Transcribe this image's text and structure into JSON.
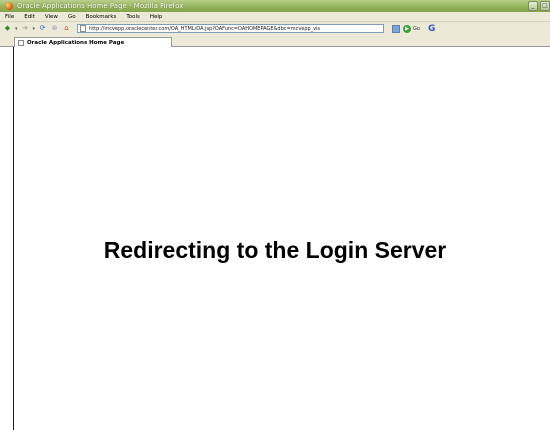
{
  "window": {
    "title": "Oracle Applications Home Page - Mozilla Firefox",
    "controls": [
      "_",
      "□"
    ]
  },
  "menu": {
    "items": [
      "File",
      "Edit",
      "View",
      "Go",
      "Bookmarks",
      "Tools",
      "Help"
    ]
  },
  "navbar": {
    "url": "http://mcvepp.oraclecenter.com/OA_HTML/OA.jsp?OAFunc=OAHOMEPAGE&dbc=mcvepp_vis",
    "go_label": "Go",
    "search_glyph": "G"
  },
  "tabs": [
    {
      "label": "Oracle Applications Home Page"
    }
  ],
  "content": {
    "message": "Redirecting to the Login Server"
  }
}
